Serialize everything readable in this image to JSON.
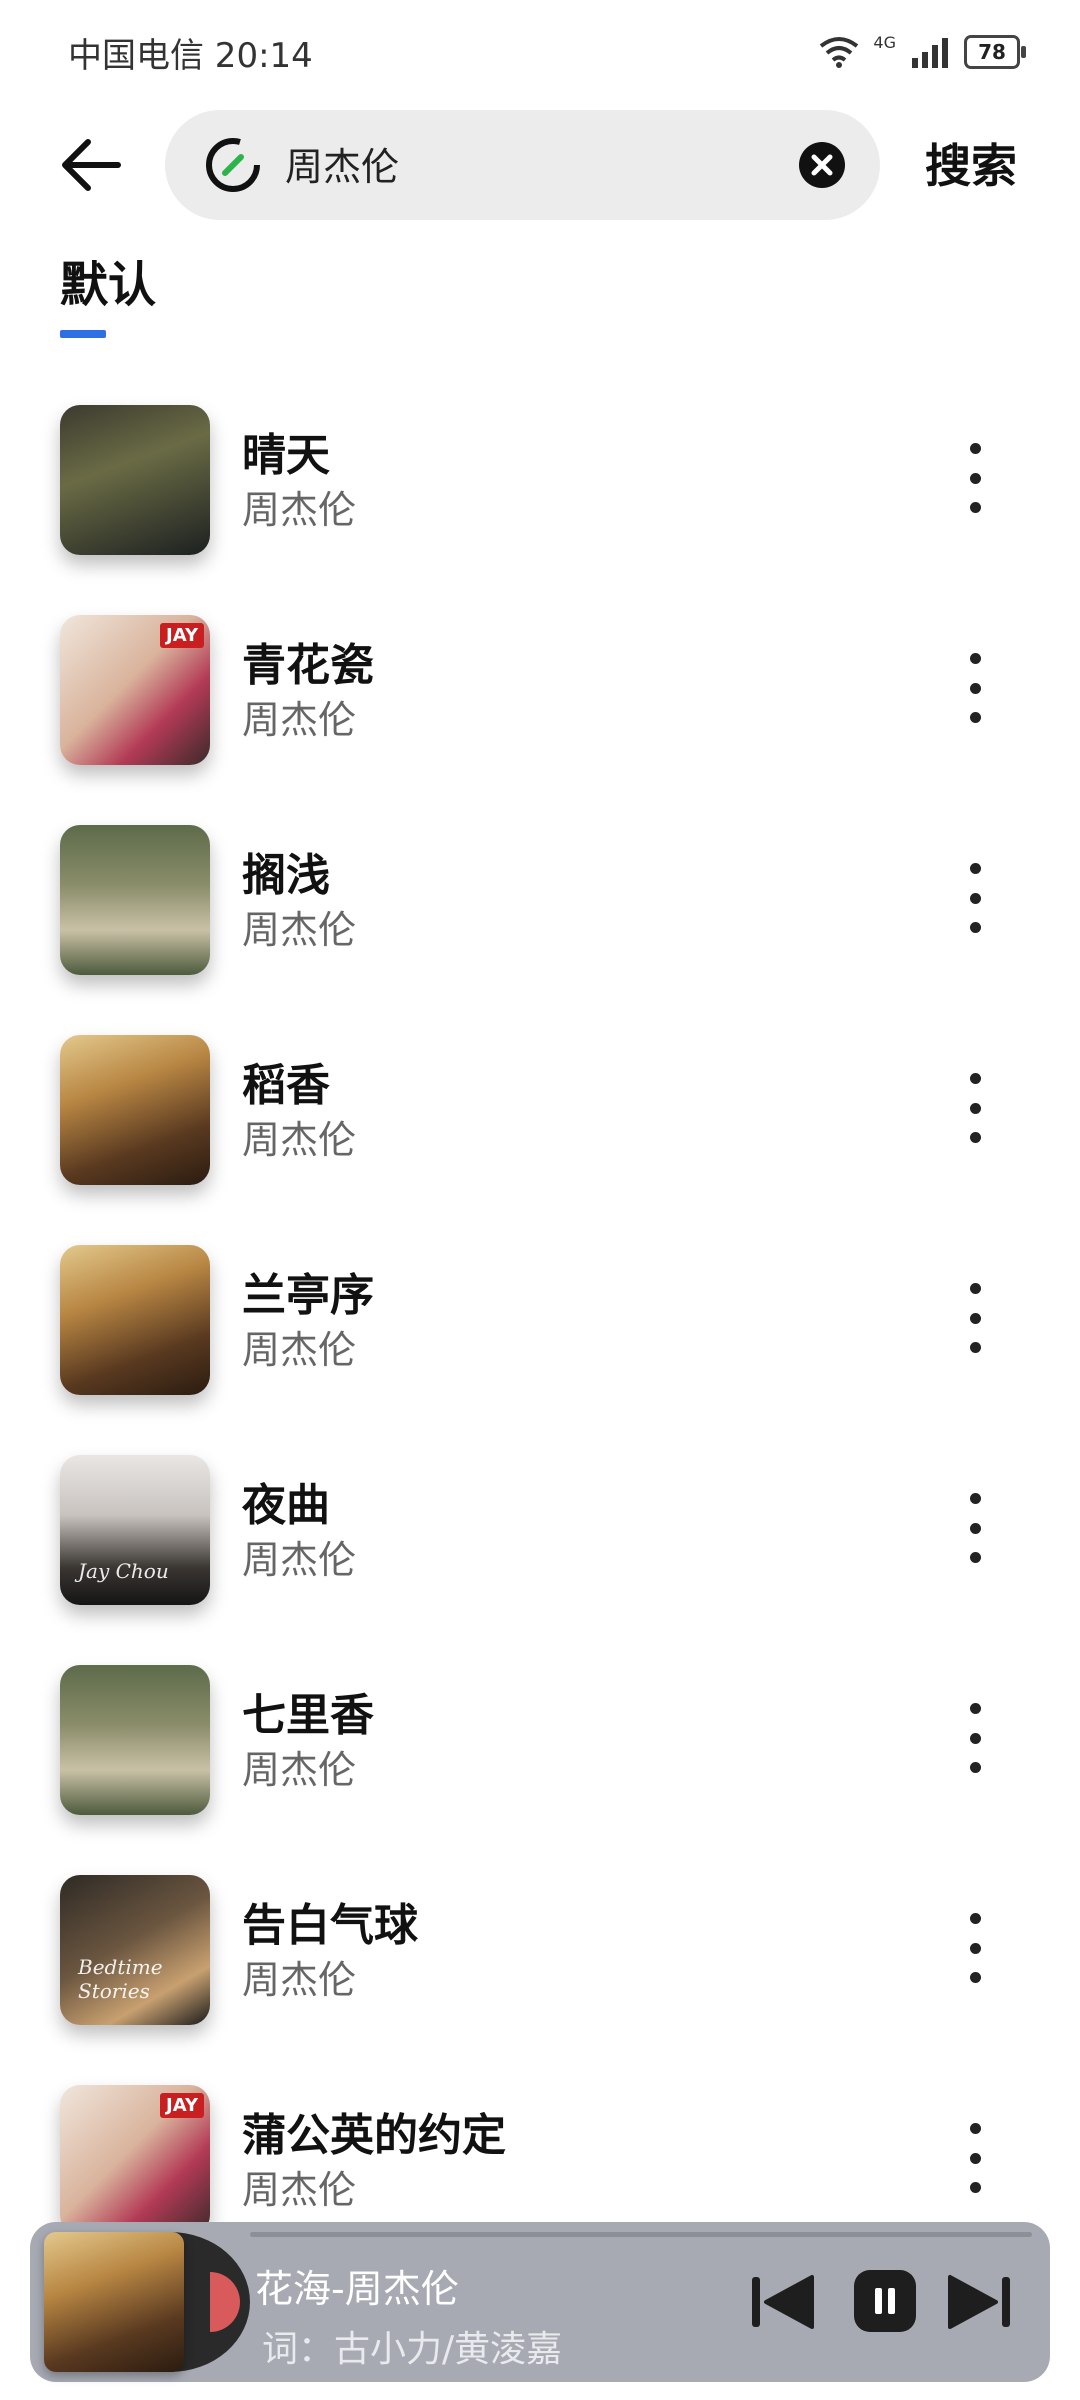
{
  "status_bar": {
    "carrier_time": "中国电信 20:14",
    "network": "4G",
    "battery": "78"
  },
  "header": {
    "query": "周杰伦",
    "search_label": "搜索"
  },
  "tabs": [
    {
      "label": "默认"
    }
  ],
  "songs": [
    {
      "title": "晴天",
      "artist": "周杰伦"
    },
    {
      "title": "青花瓷",
      "artist": "周杰伦"
    },
    {
      "title": "搁浅",
      "artist": "周杰伦"
    },
    {
      "title": "稻香",
      "artist": "周杰伦"
    },
    {
      "title": "兰亭序",
      "artist": "周杰伦"
    },
    {
      "title": "夜曲",
      "artist": "周杰伦"
    },
    {
      "title": "七里香",
      "artist": "周杰伦"
    },
    {
      "title": "告白气球",
      "artist": "周杰伦"
    },
    {
      "title": "蒲公英的约定",
      "artist": "周杰伦"
    }
  ],
  "covers": {
    "badge": "JAY",
    "night_script": "Jay Chou",
    "stories_script": "Bedtime Stories"
  },
  "player": {
    "now_playing": "花海-周杰伦",
    "lyric_line": "词：古小力/黄淩嘉"
  },
  "colors": {
    "accent": "#2f6fe4",
    "player_bg": "#a7aab3"
  }
}
